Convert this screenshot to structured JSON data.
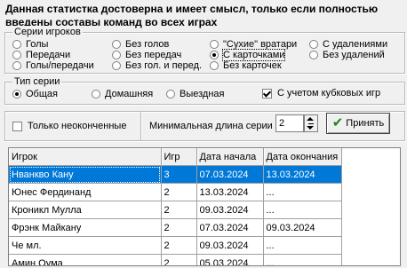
{
  "notice": "Данная статистка достоверна и имеет смысл, только если полностью введены составы команд во всех играх",
  "series_group": {
    "title": "Серии игроков",
    "options": [
      {
        "label": "Голы",
        "selected": false
      },
      {
        "label": "Передачи",
        "selected": false
      },
      {
        "label": "Голы/передачи",
        "selected": false
      },
      {
        "label": "Без голов",
        "selected": false
      },
      {
        "label": "Без передач",
        "selected": false
      },
      {
        "label": "Без гол. и перед.",
        "selected": false
      },
      {
        "label": "\"Сухие\" вратари",
        "selected": false
      },
      {
        "label": "С карточками",
        "selected": true
      },
      {
        "label": "Без карточек",
        "selected": false
      },
      {
        "label": "С удалениями",
        "selected": false
      },
      {
        "label": "Без удалений",
        "selected": false
      }
    ]
  },
  "type_group": {
    "title": "Тип серии",
    "options": [
      {
        "label": "Общая",
        "selected": true
      },
      {
        "label": "Домашняя",
        "selected": false
      },
      {
        "label": "Выездная",
        "selected": false
      }
    ],
    "cup_games": {
      "label": "С учетом кубковых игр",
      "checked": true
    }
  },
  "filter": {
    "unfinished": {
      "label": "Только неоконченные",
      "checked": false
    },
    "min_length_label": "Минимальная длина серии",
    "min_length_value": "2",
    "accept_label": "Принять"
  },
  "table": {
    "columns": [
      "Игрок",
      "Игр",
      "Дата начала",
      "Дата окончания"
    ],
    "rows": [
      {
        "player": "Нванкво Кану",
        "games": "3",
        "start": "07.03.2024",
        "end": "13.03.2024",
        "selected": true
      },
      {
        "player": "Юнес Фердинанд",
        "games": "2",
        "start": "13.03.2024",
        "end": "...",
        "selected": false
      },
      {
        "player": "Кроникл Мулла",
        "games": "2",
        "start": "09.03.2024",
        "end": "...",
        "selected": false
      },
      {
        "player": "Фрэнк Майкану",
        "games": "2",
        "start": "07.03.2024",
        "end": "09.03.2024",
        "selected": false
      },
      {
        "player": "Че мл.",
        "games": "2",
        "start": "09.03.2024",
        "end": "...",
        "selected": false
      },
      {
        "player": "Амин Оума",
        "games": "2",
        "start": "05.03.2024",
        "end": "...",
        "selected": false
      }
    ]
  }
}
